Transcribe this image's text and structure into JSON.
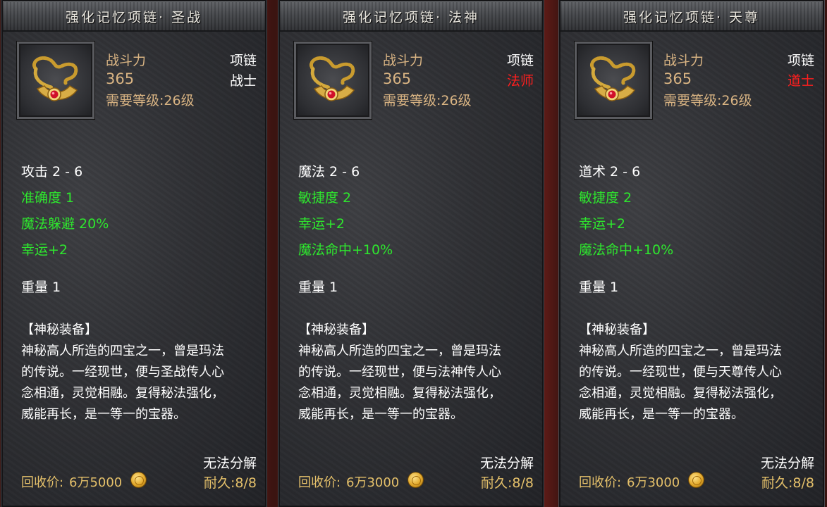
{
  "cards": [
    {
      "title": "强化记忆项链· 圣战",
      "power_label": "战斗力",
      "power_value": "365",
      "level_req": "需要等级:26级",
      "slot": "项链",
      "class_req": "战士",
      "class_color": "#ffffff",
      "attrs": [
        "攻击 2 - 6",
        "准确度 1",
        "魔法躲避 20%",
        "幸运+2"
      ],
      "weight": "重量 1",
      "desc_header": "【神秘装备】",
      "desc_lines": [
        "神秘高人所造的四宝之一，曾是玛法",
        "的传说。一经现世，便与圣战传人心",
        "念相通，灵觉相融。复得秘法强化，",
        "威能再长，是一等一的宝器。"
      ],
      "no_disassemble": "无法分解",
      "recycle_label": "回收价:",
      "recycle_value": "6万5000",
      "durability": "耐久:8/8"
    },
    {
      "title": "强化记忆项链· 法神",
      "power_label": "战斗力",
      "power_value": "365",
      "level_req": "需要等级:26级",
      "slot": "项链",
      "class_req": "法师",
      "class_color": "#ff1e1e",
      "attrs": [
        "魔法 2 - 6",
        "敏捷度 2",
        "幸运+2",
        "魔法命中+10%"
      ],
      "weight": "重量 1",
      "desc_header": "【神秘装备】",
      "desc_lines": [
        "神秘高人所造的四宝之一，曾是玛法",
        "的传说。一经现世，便与法神传人心",
        "念相通，灵觉相融。复得秘法强化，",
        "威能再长，是一等一的宝器。"
      ],
      "no_disassemble": "无法分解",
      "recycle_label": "回收价:",
      "recycle_value": "6万3000",
      "durability": "耐久:8/8"
    },
    {
      "title": "强化记忆项链· 天尊",
      "power_label": "战斗力",
      "power_value": "365",
      "level_req": "需要等级:26级",
      "slot": "项链",
      "class_req": "道士",
      "class_color": "#ff1e1e",
      "attrs": [
        "道术 2 - 6",
        "敏捷度 2",
        "幸运+2",
        "魔法命中+10%"
      ],
      "weight": "重量 1",
      "desc_header": "【神秘装备】",
      "desc_lines": [
        "神秘高人所造的四宝之一，曾是玛法",
        "的传说。一经现世，便与天尊传人心",
        "念相通，灵觉相融。复得秘法强化，",
        "威能再长，是一等一的宝器。"
      ],
      "no_disassemble": "无法分解",
      "recycle_label": "回收价:",
      "recycle_value": "6万3000",
      "durability": "耐久:8/8"
    }
  ],
  "icons": {
    "item": "gold-necklace-icon",
    "currency": "gold-coin-icon"
  },
  "colors": {
    "stat_green": "#2ee62e",
    "label_tan": "#d9b483",
    "gold_text": "#e4c06a",
    "class_restricted_red": "#ff1e1e"
  }
}
